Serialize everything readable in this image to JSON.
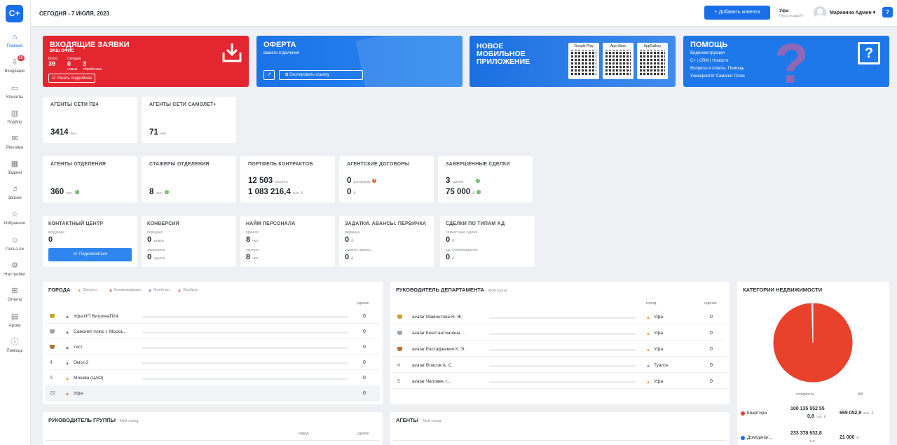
{
  "logo": "C+",
  "sidebar": {
    "items": [
      {
        "label": "Главная",
        "icon": "home-icon"
      },
      {
        "label": "Входящие",
        "icon": "inbox-icon",
        "badge": "10"
      },
      {
        "label": "Клиенты",
        "icon": "briefcase-icon"
      },
      {
        "label": "Подбор",
        "icon": "building-icon"
      },
      {
        "label": "Реклама",
        "icon": "megaphone-icon"
      },
      {
        "label": "Задачи",
        "icon": "calendar-icon"
      },
      {
        "label": "Звонки",
        "icon": "bell-icon"
      },
      {
        "label": "Избранное",
        "icon": "star-icon"
      },
      {
        "label": "Польз-ли",
        "icon": "users-icon"
      },
      {
        "label": "Настройки",
        "icon": "gear-icon"
      },
      {
        "label": "Отчеты",
        "icon": "cart-icon"
      },
      {
        "label": "Архив",
        "icon": "archive-icon"
      },
      {
        "label": "Помощь",
        "icon": "info-icon"
      }
    ]
  },
  "topbar": {
    "date": "СЕГОДНЯ - 7 ИЮЛЯ, 2023",
    "add_client": "+ Добавить клиента",
    "city": "Уфа",
    "city_sub": "Персонсада24",
    "user": "Марианна Админ ▾",
    "help": "?"
  },
  "banners": {
    "incoming": {
      "title": "ВХОДЯЩИЕ ЗАЯВКИ",
      "subtitle": "ВАШ ОФИС",
      "all_label": "Всего",
      "all": "39",
      "today_label": "Сегодня",
      "today": "0",
      "new_label": "новые",
      "new": "3",
      "processed_label": "обработано",
      "more": "Узнать подробнее"
    },
    "offer": {
      "title": "ОФЕРТА",
      "subtitle": "вашего отделения",
      "copy": "Скопировать ссылку"
    },
    "app": {
      "title_1": "НОВОЕ",
      "title_2": "МОБИЛЬНОЕ",
      "title_3": "ПРИЛОЖЕНИЕ",
      "stores": [
        "Google Play",
        "App Store",
        "AppGallery"
      ]
    },
    "help": {
      "title": "ПОМОЩЬ",
      "links": [
        "Видеоинструкция",
        "C+ | CRM | Новости",
        "Вопросы и ответы. Помощь",
        "Университет Самолет Плюс"
      ]
    }
  },
  "network": [
    {
      "title": "АГЕНТЫ СЕТИ П24",
      "value": "3414",
      "unit": "чел."
    },
    {
      "title": "АГЕНТЫ СЕТИ САМОЛЕТ+",
      "value": "71",
      "unit": "чел."
    }
  ],
  "dept": {
    "agents": {
      "title": "АГЕНТЫ ОТДЕЛЕНИЯ",
      "value": "360",
      "unit": "чел."
    },
    "trainees": {
      "title": "СТАЖЕРЫ ОТДЕЛЕНИЯ",
      "value": "8",
      "unit": "чел."
    },
    "portfolio": {
      "title": "ПОРТФЕЛЬ КОНТРАКТОВ",
      "v1": "12 503",
      "u1": "клиента",
      "v2": "1 083 216,4",
      "u2": "тыс. ₽"
    },
    "contracts": {
      "title": "АГЕНТСКИЕ ДОГОВОРЫ",
      "v1": "0",
      "u1": "договоров",
      "v2": "0",
      "u2": "₽"
    },
    "deals": {
      "title": "ЗАВЕРШЕННЫЕ СДЕЛКИ",
      "v1": "3",
      "u1": "сделки",
      "v2": "75 000",
      "u2": "₽"
    }
  },
  "ops": {
    "contact": {
      "title": "КОНТАКТНЫЙ ЦЕНТР",
      "l1": "входящие",
      "v1": "0",
      "button": "Подключиться"
    },
    "conversion": {
      "title": "КОНВЕРСИЯ",
      "l1": "передано",
      "v1": "0",
      "u1": "заявок",
      "l2": "завершено",
      "v2": "0",
      "u2": "сделок"
    },
    "hiring": {
      "title": "НАЙМ ПЕРСОНАЛА",
      "l1": "принято",
      "v1": "8",
      "u1": "чел.",
      "l2": "уволено",
      "v2": "8",
      "u2": "чел."
    },
    "deposits": {
      "title": "ЗАДАТКИ. АВАНСЫ. ПЕРВИЧКА",
      "l1": "первичка",
      "v1": "0",
      "u1": "₽",
      "l2": "задатки, авансы",
      "v2": "0",
      "u2": "₽"
    },
    "ad_deals": {
      "title": "СДЕЛКИ ПО ТИПАМ АД",
      "l1": "совместные сделки",
      "v1": "0",
      "u1": "₽",
      "l2": "юр. сопровождение",
      "v2": "0",
      "u2": "₽"
    }
  },
  "cities": {
    "title": "ГОРОДА",
    "legend": [
      {
        "label": "Эверест",
        "color": "#f0a94a"
      },
      {
        "label": "Килиманджаро",
        "color": "#e06a4a"
      },
      {
        "label": "Монблан",
        "color": "#8d8dd0"
      },
      {
        "label": "Эльбрус",
        "color": "#e87575"
      }
    ],
    "col": "сделок",
    "rows": [
      {
        "rank": "",
        "name": "Уфа ИП ВитринаП24",
        "val": "0",
        "medal": "gold",
        "tri": "#777"
      },
      {
        "rank": "",
        "name": "Самолет плюс г. Моска...",
        "val": "0",
        "medal": "silver",
        "tri": "#777"
      },
      {
        "rank": "",
        "name": "тест",
        "val": "0",
        "medal": "bronze",
        "tri": "#777"
      },
      {
        "rank": "4",
        "name": "Омск-2",
        "val": "0",
        "tri": "#777"
      },
      {
        "rank": "5",
        "name": "Москва (ЦАО)",
        "val": "0",
        "tri": "#f0a94a"
      },
      {
        "rank": "22",
        "name": "Уфа",
        "val": "0",
        "tri": "#e87575"
      }
    ]
  },
  "heads": {
    "title": "РУКОВОДИТЕЛЬ ДЕПАРТАМЕНТА",
    "sub": "Мой город",
    "col_city": "город",
    "col_deals": "сделок",
    "rows": [
      {
        "rank": "",
        "name": "avatar Мамонтова Н. Ж.",
        "city": "Уфа",
        "val": "0",
        "medal": "gold",
        "tri": "#f0a94a"
      },
      {
        "rank": "",
        "name": "avatar Константиновна ...",
        "city": "Уфа",
        "val": "0",
        "medal": "silver",
        "tri": "#f0a94a"
      },
      {
        "rank": "",
        "name": "avatar Евстафьевич К. Э.",
        "city": "Уфа",
        "val": "0",
        "medal": "bronze",
        "tri": "#f0a94a"
      },
      {
        "rank": "4",
        "name": "avatar Власов А. С.",
        "city": "Туапсе",
        "val": "0",
        "tri": "#8d8dd0"
      },
      {
        "rank": "5",
        "name": "avatar Человек т...",
        "city": "Уфа",
        "val": "0",
        "tri": "#f0a94a"
      }
    ]
  },
  "categories": {
    "title": "КАТЕГОРИИ НЕДВИЖИМОСТИ",
    "col1": "стоимость",
    "col2": "АВ",
    "rows": [
      {
        "name": "Квартира",
        "cost": "100 135 552 55",
        "cost2": "0,8",
        "cost_unit": "тыс. ₽",
        "av": "669 052,9",
        "av_unit": "тыс. ₽",
        "color": "#e8412c"
      },
      {
        "name": "Дом/дача/...",
        "cost": "233 378 932,8",
        "cost2": "",
        "cost_unit": "тыс.",
        "av": "21 000",
        "av_unit": "₽",
        "color": "#1a6fe8"
      }
    ]
  },
  "chart_data": {
    "type": "pie",
    "categories": [
      "Квартира",
      "Дом/дача/..."
    ],
    "values": [
      99.6,
      0.4
    ],
    "colors": [
      "#e8412c",
      "#1a6fe8"
    ]
  },
  "group": {
    "title": "РУКОВОДИТЕЛЬ ГРУППЫ",
    "sub": "Мой город",
    "col_city": "город",
    "col_deals": "сделок"
  },
  "agents": {
    "title": "АГЕНТЫ",
    "sub": "Мой город"
  }
}
